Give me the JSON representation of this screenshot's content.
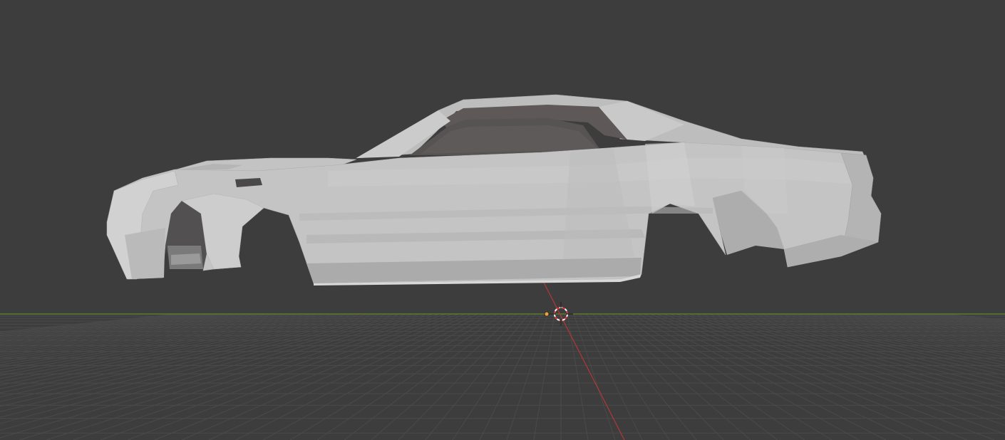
{
  "viewport": {
    "background_color": "#3d3d3d",
    "grid_color": "#4a4a4a",
    "x_axis_color": "#b03838",
    "y_axis_color": "#5f8a2b"
  },
  "scene": {
    "objects": [
      {
        "type": "mesh",
        "shape": "car-body-shell",
        "color": "#c4c4c4",
        "selected": false
      }
    ],
    "cursor": {
      "type": "3d-cursor",
      "ring_colors": [
        "#e03a3a",
        "#ffffff"
      ]
    },
    "origin": {
      "type": "object-origin",
      "color": "#e8a33a"
    }
  }
}
